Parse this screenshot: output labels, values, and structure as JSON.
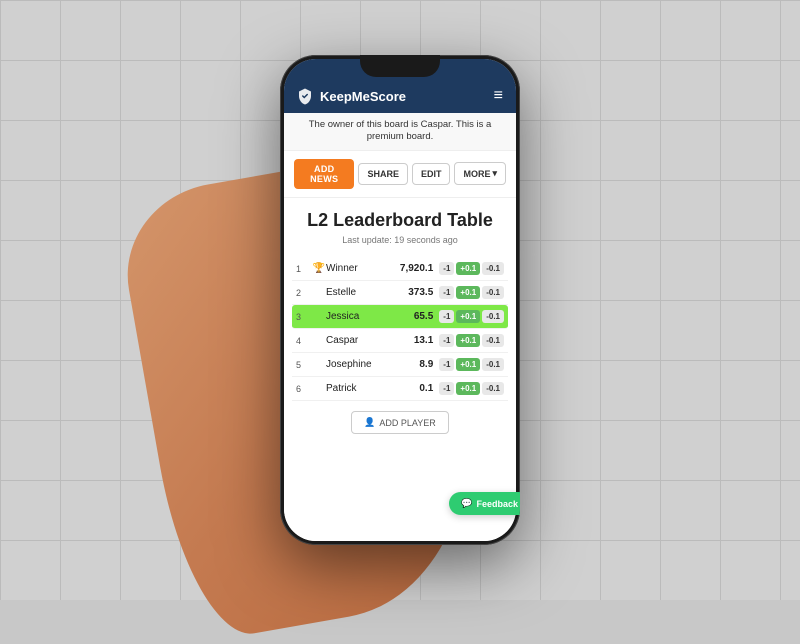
{
  "app": {
    "name": "KeepMeScore",
    "navbar_brand": "KeepMeScore"
  },
  "notice": {
    "text": "The owner of this board is Caspar. This is a premium board."
  },
  "toolbar": {
    "add_news_label": "ADD NEWS",
    "share_label": "SHARE",
    "edit_label": "EDIT",
    "more_label": "MORE"
  },
  "board": {
    "title": "L2 Leaderboard Table",
    "last_update": "Last update: 19 seconds ago"
  },
  "players": [
    {
      "rank": "1",
      "trophy": true,
      "name": "Winner",
      "score": "7,920.1",
      "highlighted": false
    },
    {
      "rank": "2",
      "trophy": false,
      "name": "Estelle",
      "score": "373.5",
      "highlighted": false
    },
    {
      "rank": "3",
      "trophy": false,
      "name": "Jessica",
      "score": "65.5",
      "highlighted": true
    },
    {
      "rank": "4",
      "trophy": false,
      "name": "Caspar",
      "score": "13.1",
      "highlighted": false
    },
    {
      "rank": "5",
      "trophy": false,
      "name": "Josephine",
      "score": "8.9",
      "highlighted": false
    },
    {
      "rank": "6",
      "trophy": false,
      "name": "Patrick",
      "score": "0.1",
      "highlighted": false
    }
  ],
  "score_buttons": {
    "minus": "-1",
    "plus": "+0.1",
    "minus_small": "-0.1"
  },
  "add_player_label": "ADD PLAYER",
  "feedback_label": "Feedback"
}
